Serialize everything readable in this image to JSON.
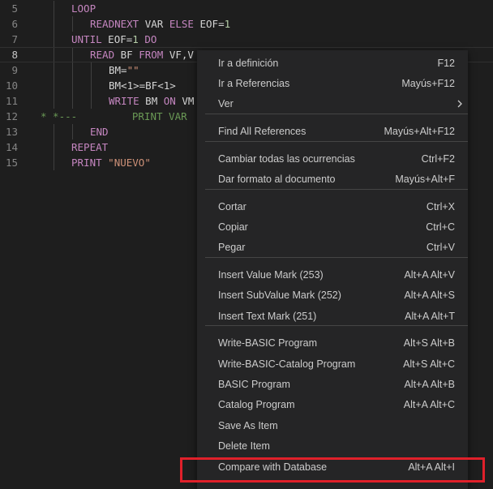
{
  "editor": {
    "lines": [
      {
        "num": "5",
        "indent": 0,
        "tokens": [
          {
            "t": "LOOP",
            "c": "kw"
          }
        ]
      },
      {
        "num": "6",
        "indent": 1,
        "tokens": [
          {
            "t": "READNEXT",
            "c": "kw"
          },
          {
            "t": " VAR ",
            "c": "tx"
          },
          {
            "t": "ELSE",
            "c": "kw"
          },
          {
            "t": " EOF=",
            "c": "tx"
          },
          {
            "t": "1",
            "c": "num"
          }
        ]
      },
      {
        "num": "7",
        "indent": 0,
        "tokens": [
          {
            "t": "UNTIL",
            "c": "kw"
          },
          {
            "t": " EOF=",
            "c": "tx"
          },
          {
            "t": "1",
            "c": "num"
          },
          {
            "t": " ",
            "c": "tx"
          },
          {
            "t": "DO",
            "c": "kw"
          }
        ]
      },
      {
        "num": "8",
        "indent": 1,
        "current": true,
        "tokens": [
          {
            "t": "READ",
            "c": "kw"
          },
          {
            "t": " BF ",
            "c": "tx"
          },
          {
            "t": "FROM",
            "c": "kw"
          },
          {
            "t": " VF,V",
            "c": "tx"
          }
        ]
      },
      {
        "num": "9",
        "indent": 2,
        "tokens": [
          {
            "t": "BM=",
            "c": "tx"
          },
          {
            "t": "\"\"",
            "c": "st"
          }
        ]
      },
      {
        "num": "10",
        "indent": 2,
        "tokens": [
          {
            "t": "BM<1>=BF<1>",
            "c": "tx"
          }
        ]
      },
      {
        "num": "11",
        "indent": 2,
        "tokens": [
          {
            "t": "WRITE",
            "c": "kw"
          },
          {
            "t": " BM ",
            "c": "tx"
          },
          {
            "t": "ON",
            "c": "kw"
          },
          {
            "t": " VM",
            "c": "tx"
          }
        ]
      },
      {
        "num": "12",
        "indent": -1,
        "tokens": [
          {
            "t": "* *---         PRINT VAR",
            "c": "cm"
          }
        ]
      },
      {
        "num": "13",
        "indent": 1,
        "tokens": [
          {
            "t": "END",
            "c": "kw"
          }
        ]
      },
      {
        "num": "14",
        "indent": 0,
        "tokens": [
          {
            "t": "REPEAT",
            "c": "kw"
          }
        ]
      },
      {
        "num": "15",
        "indent": 0,
        "tokens": [
          {
            "t": "PRINT",
            "c": "kw"
          },
          {
            "t": " ",
            "c": "tx"
          },
          {
            "t": "\"NUEVO\"",
            "c": "st"
          }
        ]
      }
    ]
  },
  "context_menu": {
    "groups": [
      [
        {
          "label": "Ir a definición",
          "shortcut": "F12"
        },
        {
          "label": "Ir a Referencias",
          "shortcut": "Mayús+F12"
        },
        {
          "label": "Ver",
          "shortcut": "",
          "submenu": true
        }
      ],
      [
        {
          "label": "Find All References",
          "shortcut": "Mayús+Alt+F12"
        }
      ],
      [
        {
          "label": "Cambiar todas las ocurrencias",
          "shortcut": "Ctrl+F2"
        },
        {
          "label": "Dar formato al documento",
          "shortcut": "Mayús+Alt+F"
        }
      ],
      [
        {
          "label": "Cortar",
          "shortcut": "Ctrl+X"
        },
        {
          "label": "Copiar",
          "shortcut": "Ctrl+C"
        },
        {
          "label": "Pegar",
          "shortcut": "Ctrl+V"
        }
      ],
      [
        {
          "label": "Insert Value Mark (253)",
          "shortcut": "Alt+A Alt+V"
        },
        {
          "label": "Insert SubValue Mark (252)",
          "shortcut": "Alt+A Alt+S"
        },
        {
          "label": "Insert Text Mark (251)",
          "shortcut": "Alt+A Alt+T"
        }
      ],
      [
        {
          "label": "Write-BASIC Program",
          "shortcut": "Alt+S Alt+B"
        },
        {
          "label": "Write-BASIC-Catalog Program",
          "shortcut": "Alt+S Alt+C"
        },
        {
          "label": "BASIC Program",
          "shortcut": "Alt+A Alt+B"
        },
        {
          "label": "Catalog Program",
          "shortcut": "Alt+A Alt+C"
        },
        {
          "label": "Save As Item",
          "shortcut": ""
        },
        {
          "label": "Delete Item",
          "shortcut": ""
        },
        {
          "label": "Compare with Database",
          "shortcut": "Alt+A Alt+I",
          "highlighted": true
        }
      ]
    ],
    "submenu_icon": "chevron-right-icon"
  },
  "colors": {
    "background": "#1e1e1e",
    "menu_background": "#252526",
    "keyword": "#c586c0",
    "string": "#ce9178",
    "number": "#b5cea8",
    "comment": "#6a9955",
    "highlight_border": "#e0202a"
  }
}
